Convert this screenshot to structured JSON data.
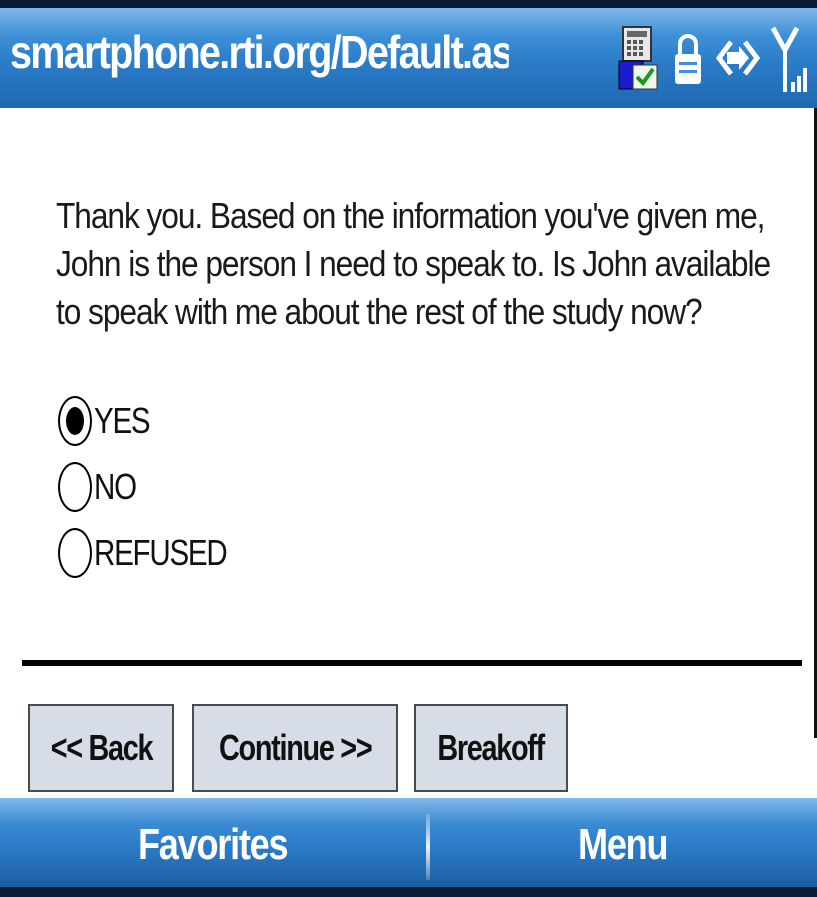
{
  "titlebar": {
    "url": "smartphone.rti.org/Default.aspx:"
  },
  "status_icons": [
    "notification-icon",
    "lock-icon",
    "data-connection-icon",
    "signal-strength-icon"
  ],
  "question": {
    "text": "Thank you.  Based on the information you've given me, John is the person I need to speak to.  Is John available to speak with me about the rest of the study now?"
  },
  "options": [
    {
      "label": "YES",
      "selected": true
    },
    {
      "label": "NO",
      "selected": false
    },
    {
      "label": "REFUSED",
      "selected": false
    }
  ],
  "buttons": {
    "back": "<< Back",
    "continue": "Continue >>",
    "breakoff": "Breakoff"
  },
  "softkeys": {
    "left": "Favorites",
    "right": "Menu"
  },
  "colors": {
    "bar_blue": "#2b7cc8",
    "button_bg": "#d6dde6"
  }
}
